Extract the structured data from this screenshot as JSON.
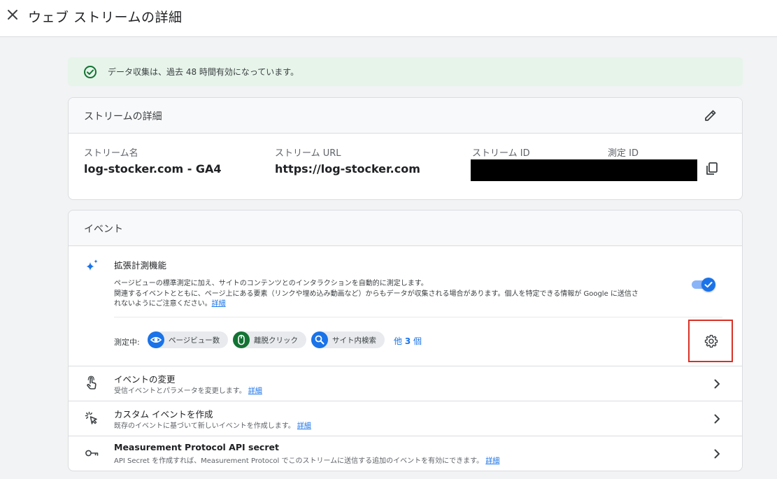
{
  "header": {
    "title": "ウェブ ストリームの詳細"
  },
  "banner": {
    "text": "データ収集は、過去 48 時間有効になっています。"
  },
  "stream_details": {
    "title": "ストリームの詳細",
    "fields": {
      "name_label": "ストリーム名",
      "name_value": "log-stocker.com - GA4",
      "url_label": "ストリーム URL",
      "url_value": "https://log-stocker.com",
      "stream_id_label": "ストリーム ID",
      "measurement_id_label": "測定 ID"
    }
  },
  "events": {
    "title": "イベント",
    "enhanced_measurement": {
      "title": "拡張計測機能",
      "description_line1": "ページビューの標準測定に加え、サイトのコンテンツとのインタラクションを自動的に測定します。",
      "description_line2": "関連するイベントとともに、ページ上にある要素（リンクや埋め込み動画など）からもデータが収集される場合があります。個人を特定できる情報が Google に送信さ",
      "description_line3": "れないようにご注意ください。",
      "details_link": "詳細",
      "toggle_on": true,
      "measuring_label": "測定中:",
      "chips": [
        {
          "label": "ページビュー数",
          "icon": "eye-icon",
          "color": "#1a73e8"
        },
        {
          "label": "離脱クリック",
          "icon": "mouse-icon",
          "color": "#137333"
        },
        {
          "label": "サイト内検索",
          "icon": "search-icon",
          "color": "#1a73e8"
        }
      ],
      "more_prefix": "他 ",
      "more_count": "3",
      "more_suffix": " 個"
    },
    "rows": [
      {
        "title": "イベントの変更",
        "description": "受信イベントとパラメータを変更します。",
        "link": "詳細",
        "icon": "touch-icon"
      },
      {
        "title": "カスタム イベントを作成",
        "description": "既存のイベントに基づいて新しいイベントを作成します。",
        "link": "詳細",
        "icon": "sparkle-click-icon"
      },
      {
        "title": "Measurement Protocol API secret",
        "description": "API Secret を作成すれば、Measurement Protocol でこのストリームに送信する追加のイベントを有効にできます。",
        "link": "詳細",
        "icon": "key-icon"
      }
    ]
  },
  "colors": {
    "accent": "#1a73e8",
    "success": "#137333",
    "banner_bg": "#e6f4ea",
    "highlight": "#d93025"
  }
}
